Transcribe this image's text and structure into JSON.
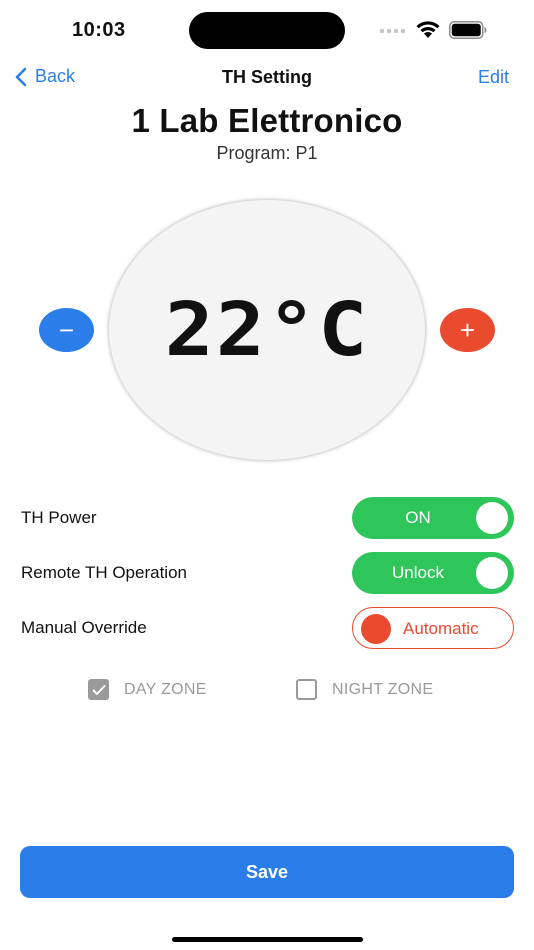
{
  "status_bar": {
    "time": "10:03",
    "icons": [
      "cellular-dots-icon",
      "wifi-icon",
      "battery-icon"
    ]
  },
  "nav": {
    "back_label": "Back",
    "title": "TH Setting",
    "edit_label": "Edit"
  },
  "device": {
    "name": "1 Lab Elettronico",
    "program": "Program: P1"
  },
  "thermostat": {
    "temperature": "22°C",
    "decrease_symbol": "−",
    "increase_symbol": "+"
  },
  "settings": [
    {
      "label": "TH Power",
      "value": "ON",
      "state": "on"
    },
    {
      "label": "Remote TH Operation",
      "value": "Unlock",
      "state": "on"
    },
    {
      "label": "Manual Override",
      "value": "Automatic",
      "state": "automatic"
    }
  ],
  "zones": {
    "day": {
      "label": "DAY ZONE",
      "checked": true
    },
    "night": {
      "label": "NIGHT ZONE",
      "checked": false
    }
  },
  "actions": {
    "save_label": "Save"
  },
  "colors": {
    "accent_blue": "#2b7de9",
    "accent_red": "#ea4a2e",
    "toggle_green": "#2ec55a",
    "zone_gray": "#9a9a9a"
  }
}
